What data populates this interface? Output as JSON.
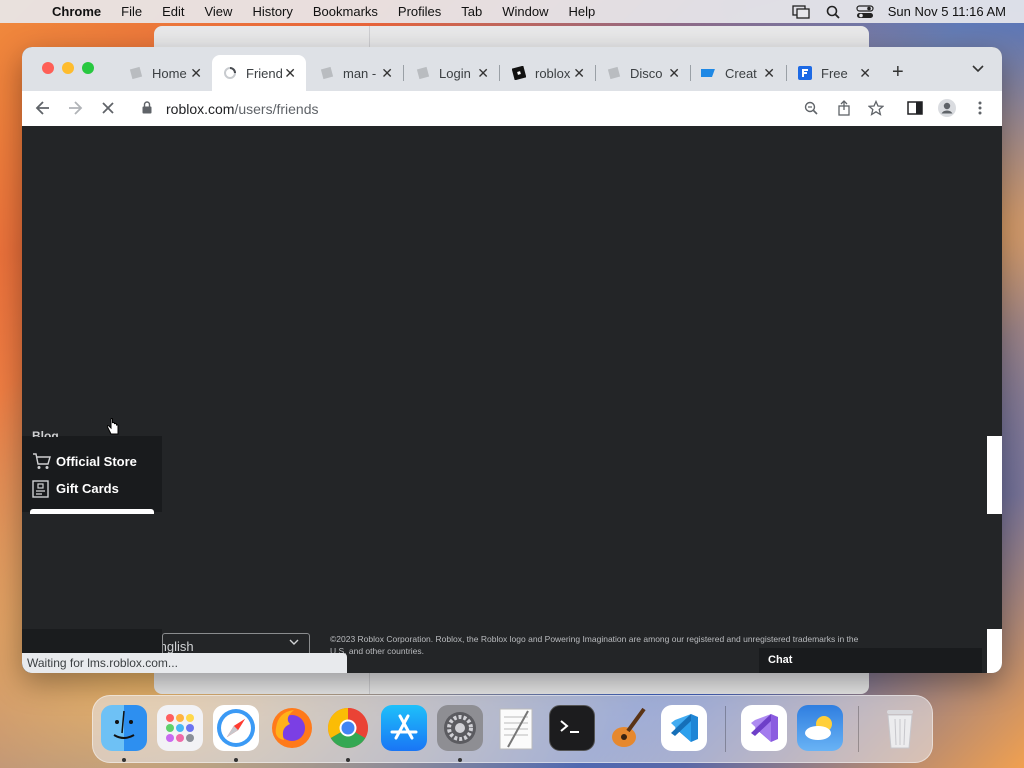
{
  "menubar": {
    "app": "Chrome",
    "items": [
      "File",
      "Edit",
      "View",
      "History",
      "Bookmarks",
      "Profiles",
      "Tab",
      "Window",
      "Help"
    ],
    "clock": "Sun Nov 5  11:16 AM"
  },
  "tabs": [
    {
      "label": "Home",
      "icon": "roblox-gray-icon",
      "active": false
    },
    {
      "label": "Friends",
      "icon": "loading-spinner-icon",
      "active": true
    },
    {
      "label": "man -",
      "icon": "roblox-gray-icon",
      "active": false
    },
    {
      "label": "Login",
      "icon": "roblox-gray-icon",
      "active": false
    },
    {
      "label": "roblox",
      "icon": "roblox-black-icon",
      "active": false
    },
    {
      "label": "Disco",
      "icon": "roblox-gray-icon",
      "active": false
    },
    {
      "label": "Creat",
      "icon": "roblox-studio-icon",
      "active": false
    },
    {
      "label": "Free",
      "icon": "f-blue-icon",
      "active": false
    }
  ],
  "address": {
    "host": "roblox.com",
    "path": "/users/friends"
  },
  "menu": {
    "partial_item": "Blog",
    "items": [
      "Official Store",
      "Gift Cards"
    ]
  },
  "footer": {
    "language": "English",
    "copyright": "©2023 Roblox Corporation. Roblox, the Roblox logo and Powering Imagination are among our registered and unregistered trademarks in the U.S. and other countries."
  },
  "status": "Waiting for lms.roblox.com...",
  "chat": "Chat",
  "dock": [
    "Finder",
    "Launchpad",
    "Safari",
    "Firefox",
    "Chrome",
    "App Store",
    "System Settings",
    "TextEdit",
    "Terminal",
    "GarageBand",
    "VS Code",
    "Visual Studio",
    "Weather",
    "Trash"
  ],
  "colors": {
    "page_bg": "#232527",
    "tabstrip": "#dee1e6",
    "menu_bg": "#191b1d"
  }
}
